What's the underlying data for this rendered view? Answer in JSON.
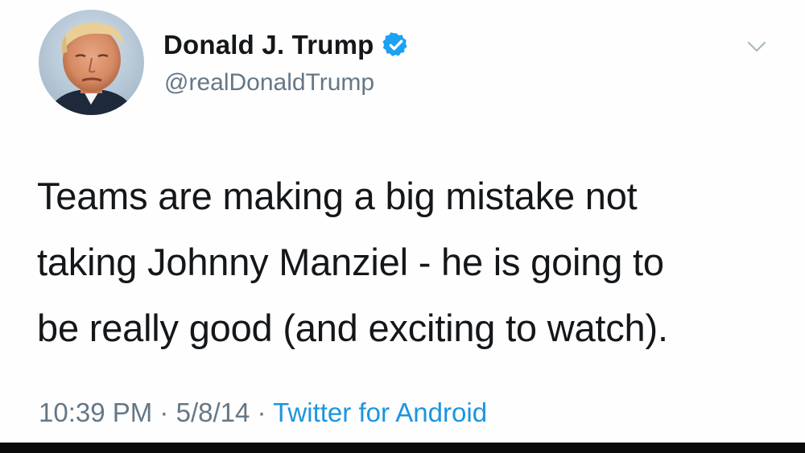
{
  "user": {
    "display_name": "Donald J. Trump",
    "handle": "@realDonaldTrump",
    "verified": true,
    "avatar_icon": "profile-photo"
  },
  "tweet": {
    "text_lines": [
      "Teams are making a big mistake not",
      "taking Johnny Manziel - he is going to",
      "be really good (and exciting to watch)."
    ],
    "time": "10:39 PM",
    "separator": "·",
    "date": "5/8/14",
    "source": "Twitter for Android"
  },
  "icons": {
    "verified": "verified-badge-icon",
    "menu": "chevron-down-icon"
  },
  "colors": {
    "text": "#14171a",
    "secondary": "#657786",
    "link": "#1b95e0",
    "verified": "#1da1f2"
  }
}
